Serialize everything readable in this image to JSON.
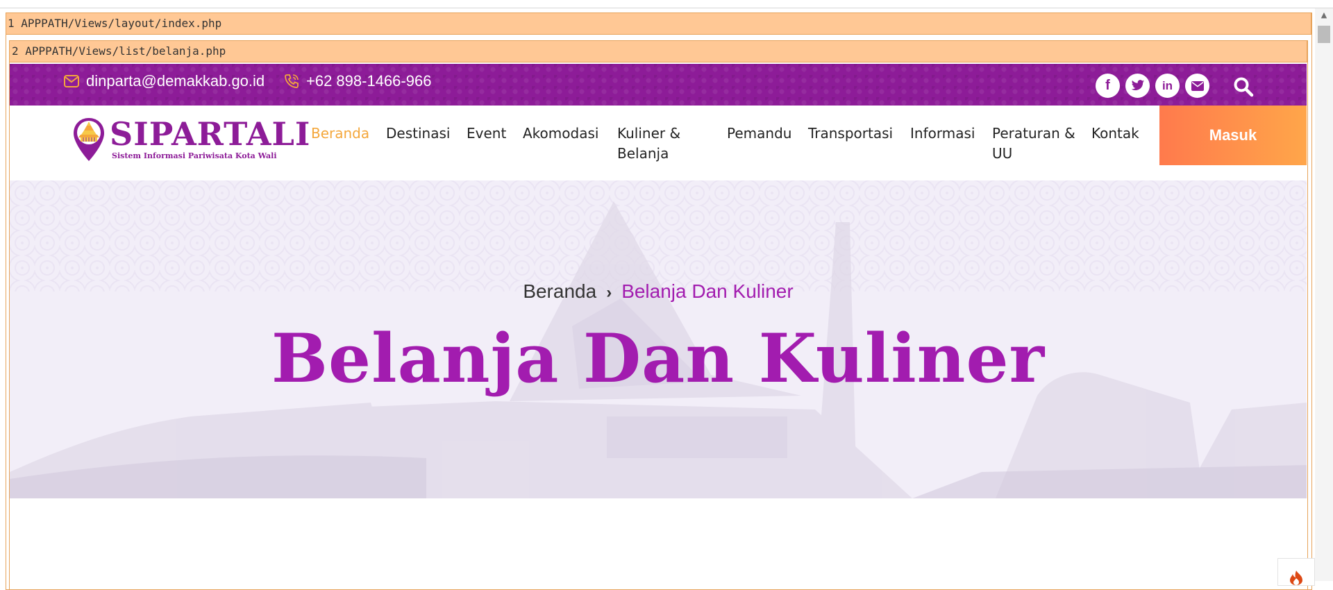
{
  "debug": {
    "outer_label": "1 APPPATH/Views/layout/index.php",
    "inner_label": "2 APPPATH/Views/list/belanja.php"
  },
  "topbar": {
    "email": "dinparta@demakkab.go.id",
    "phone": "+62 898-1466-966",
    "social": [
      {
        "icon": "facebook-icon",
        "glyph": "f"
      },
      {
        "icon": "twitter-icon",
        "glyph": ""
      },
      {
        "icon": "linkedin-icon",
        "glyph": "in"
      },
      {
        "icon": "envelope-icon",
        "glyph": ""
      }
    ]
  },
  "logo": {
    "name": "SIPARTALI",
    "tagline": "Sistem Informasi Pariwisata Kota Wali"
  },
  "nav": {
    "items": [
      {
        "label": "Beranda",
        "active": true
      },
      {
        "label": "Destinasi"
      },
      {
        "label": "Event"
      },
      {
        "label": "Akomodasi"
      },
      {
        "label": "Kuliner & Belanja"
      },
      {
        "label": "Pemandu"
      },
      {
        "label": "Transportasi"
      },
      {
        "label": "Informasi"
      },
      {
        "label": "Peraturan & UU"
      },
      {
        "label": "Kontak"
      }
    ],
    "login_label": "Masuk"
  },
  "hero": {
    "breadcrumb_home": "Beranda",
    "breadcrumb_current": "Belanja Dan Kuliner",
    "title": "Belanja Dan Kuliner"
  },
  "colors": {
    "brand_purple": "#8d1c98",
    "title_purple": "#a21caf",
    "active_orange": "#f4a73b",
    "button_gradient_start": "#ff7a4c",
    "button_gradient_end": "#ffa64a"
  }
}
